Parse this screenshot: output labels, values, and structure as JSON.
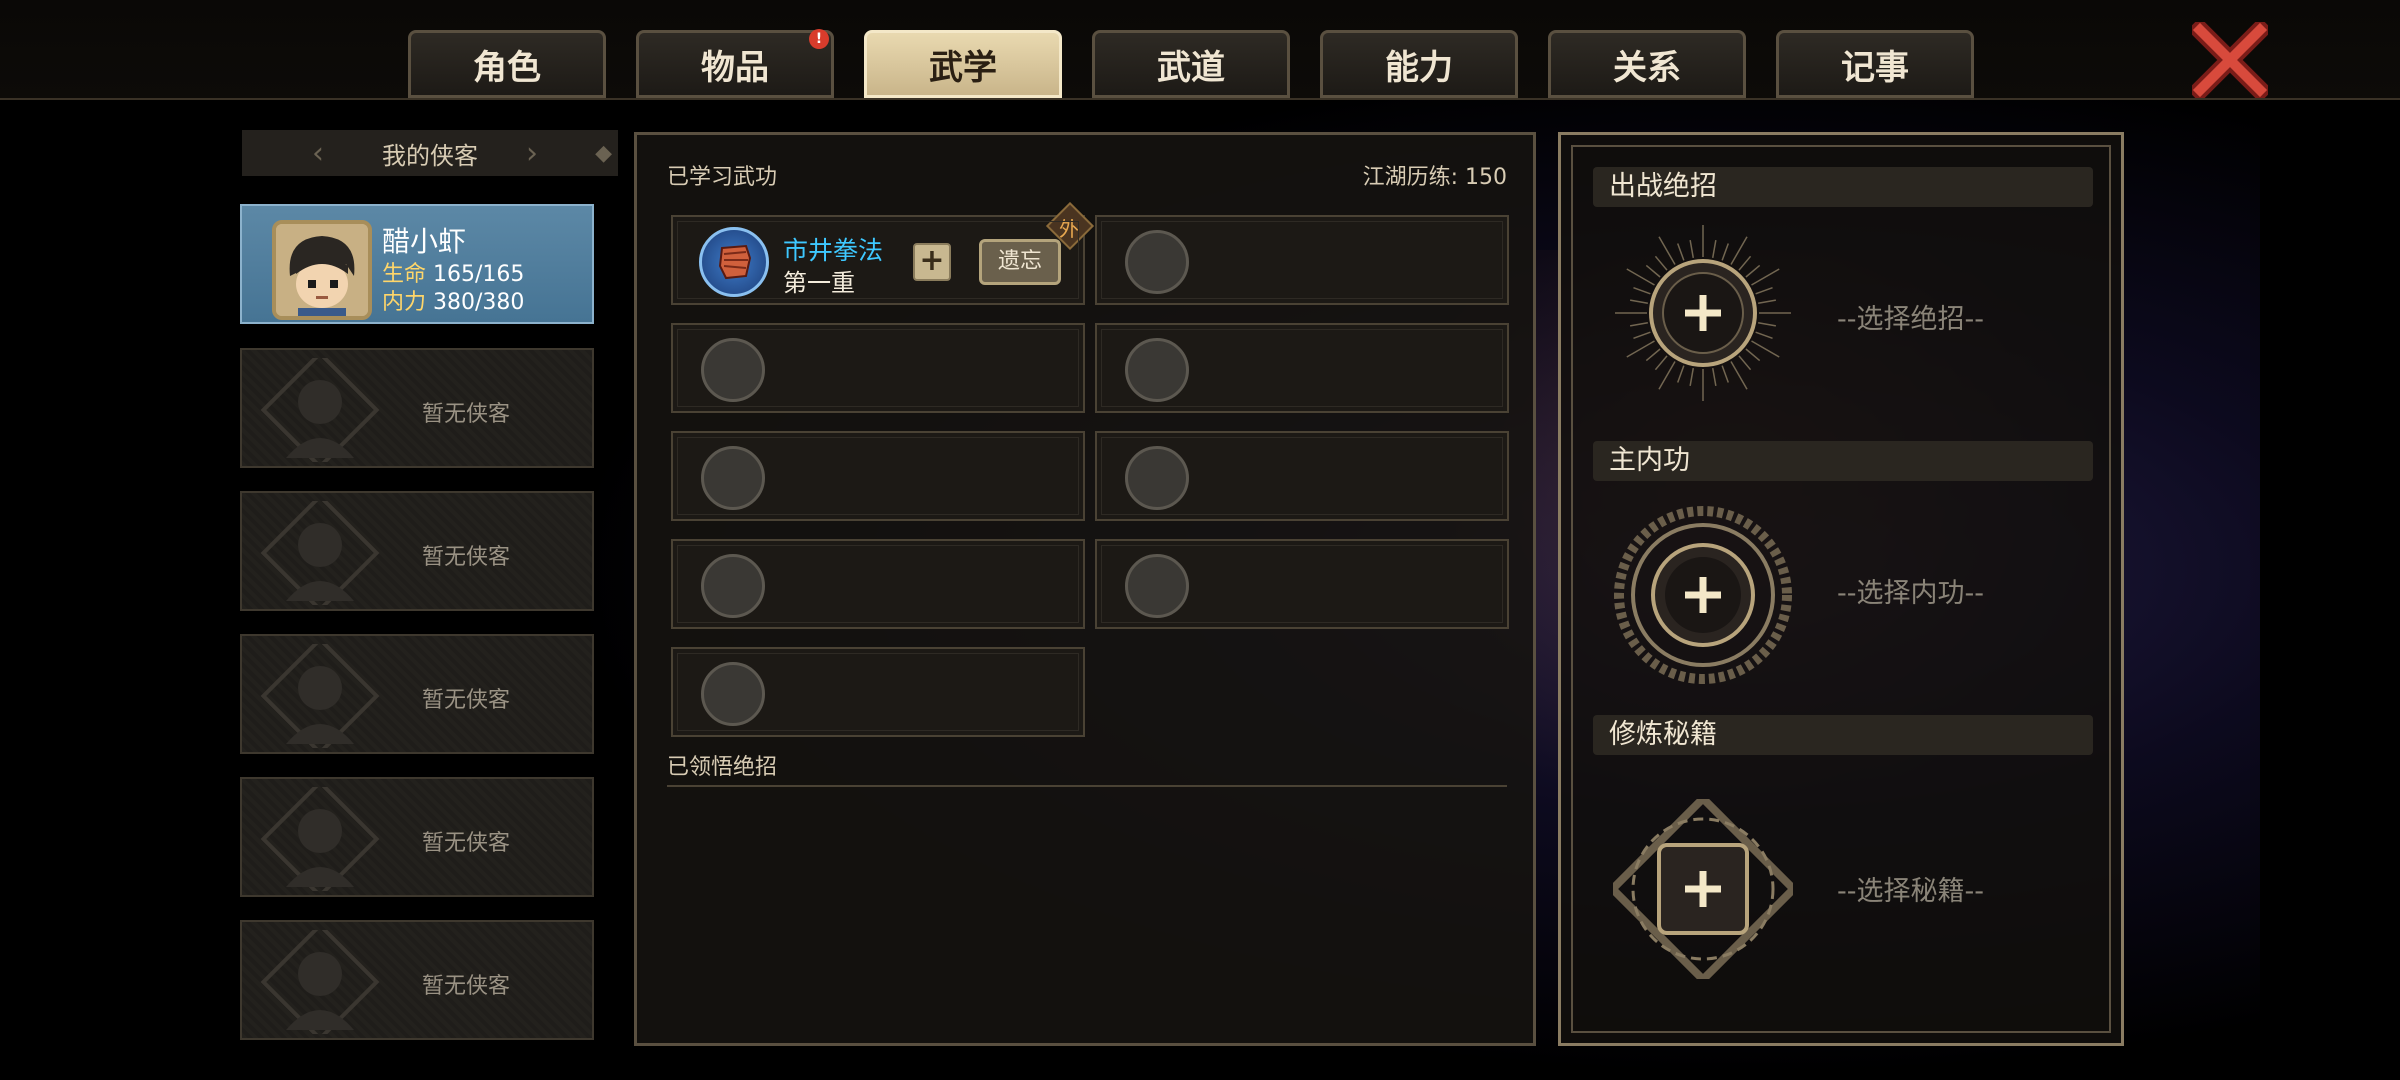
{
  "tabs": [
    {
      "label": "角色",
      "active": false,
      "badge": ""
    },
    {
      "label": "物品",
      "active": false,
      "badge": "!"
    },
    {
      "label": "武学",
      "active": true,
      "badge": ""
    },
    {
      "label": "武道",
      "active": false,
      "badge": ""
    },
    {
      "label": "能力",
      "active": false,
      "badge": ""
    },
    {
      "label": "关系",
      "active": false,
      "badge": ""
    },
    {
      "label": "记事",
      "active": false,
      "badge": ""
    }
  ],
  "close_icon": "close-x-icon",
  "left": {
    "header": "我的侠客",
    "hero": {
      "name": "醋小虾",
      "hp_label": "生命",
      "hp_value": "165/165",
      "mp_label": "内力",
      "mp_value": "380/380"
    },
    "empty_label": "暂无侠客",
    "empty_slots": 5
  },
  "middle": {
    "title": "已学习武功",
    "xp_text": "江湖历练: 150",
    "learned": {
      "name": "市井拳法",
      "level": "第一重",
      "type_tag": "外",
      "forget_label": "遗忘",
      "plus_label": "+"
    },
    "empty_slots": 8,
    "section2_title": "已领悟绝招"
  },
  "right": {
    "ultimate": {
      "header": "出战绝招",
      "hint": "--选择绝招--"
    },
    "inner": {
      "header": "主内功",
      "hint": "--选择内功--"
    },
    "manual": {
      "header": "修炼秘籍",
      "hint": "--选择秘籍--"
    }
  },
  "colors": {
    "accent": "#c9b58a",
    "skill_name": "#3ec8ff",
    "stat_label": "#ffd66a",
    "badge": "#d83c2c",
    "active_slot": "#4f7d9c"
  }
}
